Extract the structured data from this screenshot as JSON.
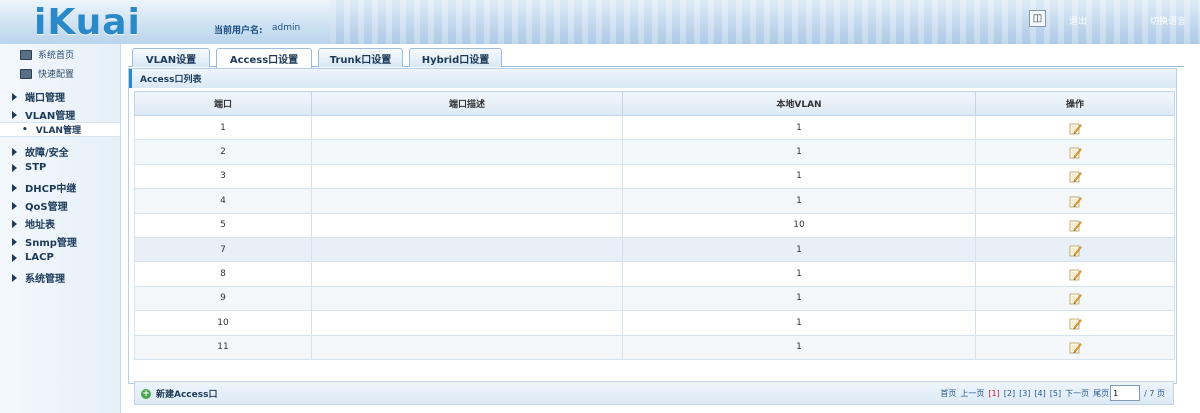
{
  "header": {
    "logo": "iKuai",
    "user_label": "当前用户名:",
    "user_name": "admin",
    "logout": "退出",
    "switch_lang": "切换语言"
  },
  "sidebar": {
    "top_items": [
      "系统首页",
      "快速配置"
    ],
    "items": [
      "端口管理",
      "VLAN管理",
      "故障/安全",
      "STP",
      "DHCP中继",
      "QoS管理",
      "地址表",
      "Snmp管理",
      "LACP",
      "系统管理"
    ],
    "sub_item": "VLAN管理"
  },
  "tabs": [
    "VLAN设置",
    "Access口设置",
    "Trunk口设置",
    "Hybrid口设置"
  ],
  "active_tab": "Access口设置",
  "panel": {
    "title": "Access口列表",
    "columns": [
      "端口",
      "端口描述",
      "本地VLAN",
      "操作"
    ],
    "rows": [
      {
        "port": "1",
        "desc": "",
        "vlan": "1"
      },
      {
        "port": "2",
        "desc": "",
        "vlan": "1"
      },
      {
        "port": "3",
        "desc": "",
        "vlan": "1"
      },
      {
        "port": "4",
        "desc": "",
        "vlan": "1"
      },
      {
        "port": "5",
        "desc": "",
        "vlan": "10"
      },
      {
        "port": "7",
        "desc": "",
        "vlan": "1"
      },
      {
        "port": "8",
        "desc": "",
        "vlan": "1"
      },
      {
        "port": "9",
        "desc": "",
        "vlan": "1"
      },
      {
        "port": "10",
        "desc": "",
        "vlan": "1"
      },
      {
        "port": "11",
        "desc": "",
        "vlan": "1"
      }
    ],
    "add_label": "新建Access口"
  },
  "pager": {
    "first": "首页",
    "prev": "上一页",
    "pages": [
      "[1]",
      "[2]",
      "[3]",
      "[4]",
      "[5]"
    ],
    "current": "[1]",
    "next": "下一页",
    "last": "尾页",
    "input_value": "1",
    "total": "/ 7 页"
  },
  "colors": {
    "accent": "#2a89c9",
    "header_text": "#1a4c80",
    "current_page": "#d02020"
  }
}
